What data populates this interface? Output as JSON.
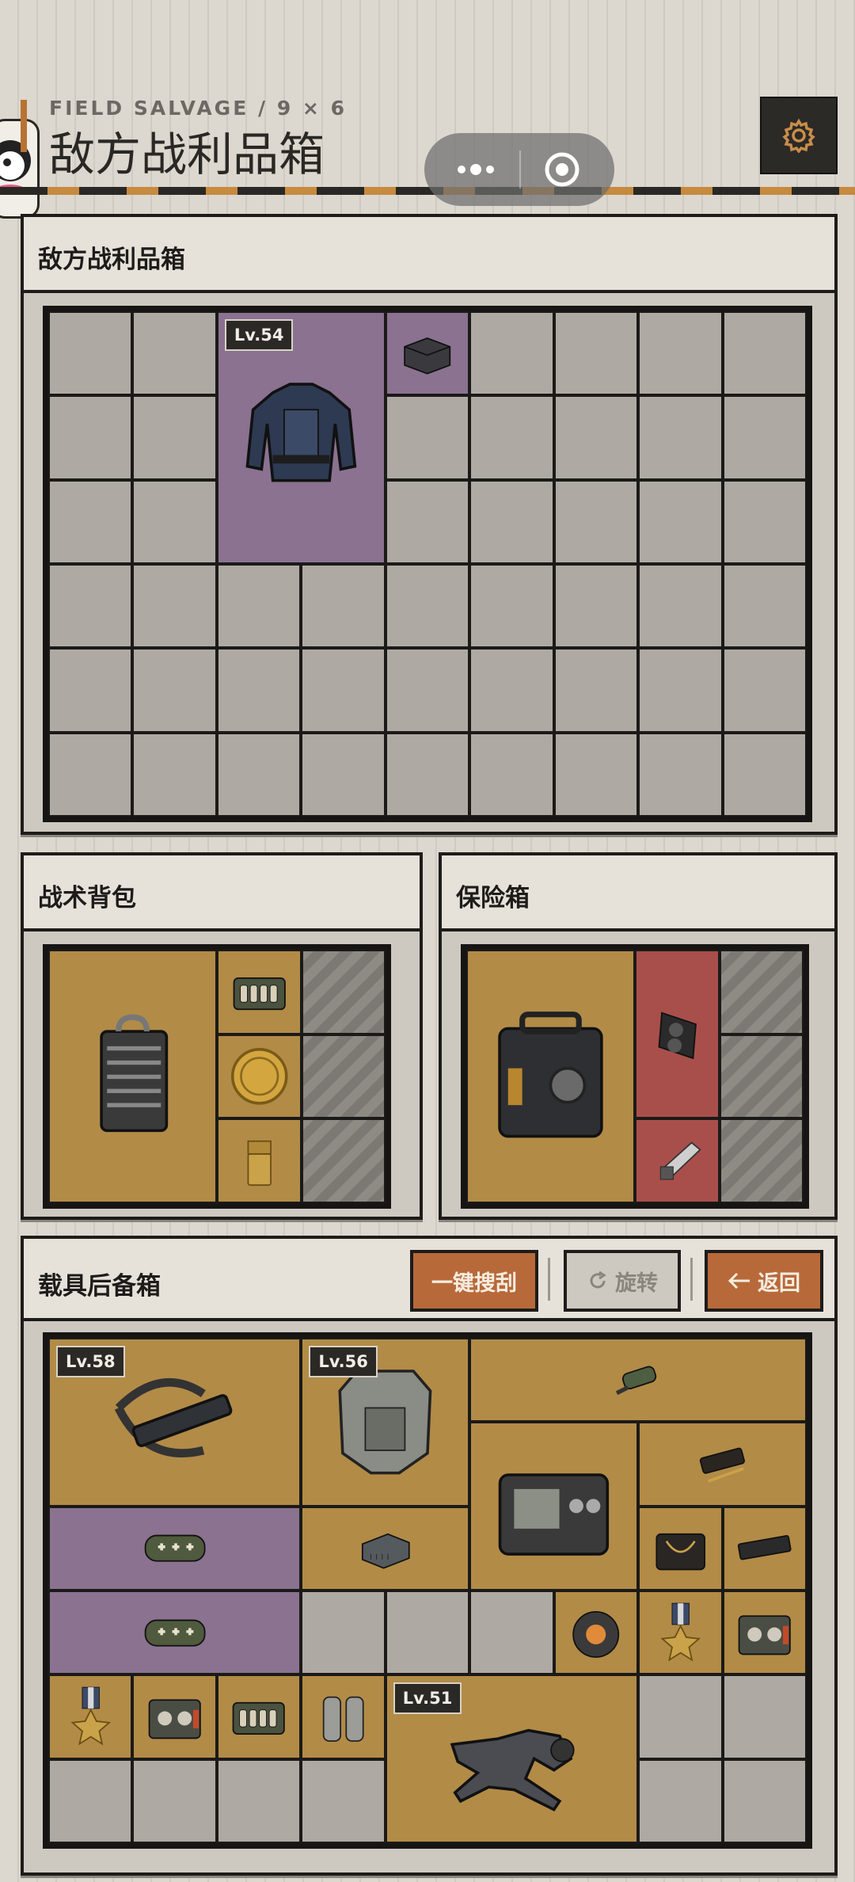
{
  "header": {
    "subtitle": "FIELD SALVAGE / 9 × 6",
    "title": "敌方战利品箱"
  },
  "panels": {
    "loot": {
      "title": "敌方战利品箱",
      "cols": 9,
      "rows": 6
    },
    "backpack": {
      "title": "战术背包"
    },
    "safe": {
      "title": "保险箱"
    },
    "vehicle": {
      "title": "载具后备箱"
    }
  },
  "buttons": {
    "auto_search": "一键搜刮",
    "rotate": "旋转",
    "back": "返回"
  },
  "levels": {
    "loot_armor": "Lv.54",
    "crossbow": "Lv.58",
    "vest": "Lv.56",
    "suit": "Lv.51"
  },
  "icons": {
    "settings": "gear-icon",
    "capsule_menu": "more-dots-icon",
    "capsule_close": "target-icon",
    "rotate": "rotate-icon",
    "back": "arrow-left-icon"
  },
  "colors": {
    "gold_slot": "#b28b47",
    "purple_slot": "#8a7290",
    "red_slot": "#a94f4b",
    "button_orange": "#b8693a",
    "accent": "#b87333"
  }
}
